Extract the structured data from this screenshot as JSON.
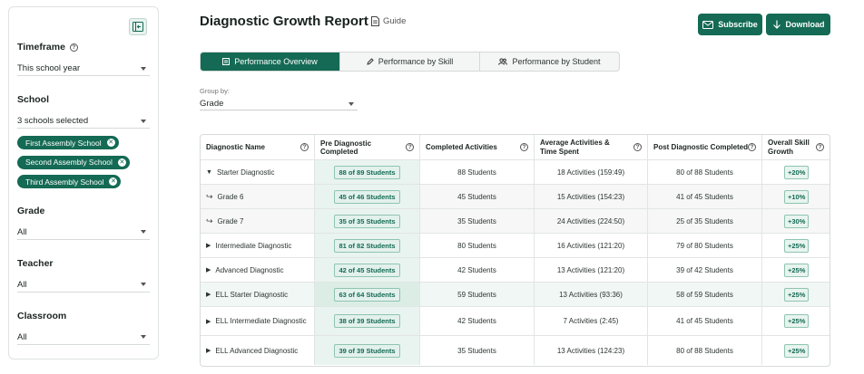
{
  "sidebar": {
    "filters": {
      "timeframe": {
        "label": "Timeframe",
        "value": "This school year"
      },
      "school": {
        "label": "School",
        "value": "3 schools selected",
        "chips": [
          "First Assembly School",
          "Second Assembly School",
          "Third Assembly School"
        ]
      },
      "grade": {
        "label": "Grade",
        "value": "All"
      },
      "teacher": {
        "label": "Teacher",
        "value": "All"
      },
      "classroom": {
        "label": "Classroom",
        "value": "All"
      }
    }
  },
  "header": {
    "title": "Diagnostic Growth Report",
    "guide": "Guide",
    "subscribe": "Subscribe",
    "download": "Download"
  },
  "tabs": [
    "Performance Overview",
    "Performance by Skill",
    "Performance by Student"
  ],
  "group_by": {
    "label": "Group by:",
    "value": "Grade"
  },
  "table": {
    "headers": [
      "Diagnostic Name",
      "Pre Diagnostic Completed",
      "Completed Activities",
      "Average Activities & Time Spent",
      "Post Diagnostic Completed",
      "Overall Skill Growth"
    ],
    "rows": [
      {
        "name": "Starter Diagnostic",
        "pre": "88 of 89 Students",
        "completed": "88 Students",
        "avg": "18 Activities (159:49)",
        "post": "80 of 88 Students",
        "growth": "+20%"
      },
      {
        "name": "Grade 6",
        "pre": "45 of 46 Students",
        "completed": "45 Students",
        "avg": "15 Activities (154:23)",
        "post": "41 of 45 Students",
        "growth": "+10%"
      },
      {
        "name": "Grade 7",
        "pre": "35 of 35 Students",
        "completed": "35 Students",
        "avg": "24 Activities (224:50)",
        "post": "25 of 35 Students",
        "growth": "+30%"
      },
      {
        "name": "Intermediate Diagnostic",
        "pre": "81 of 82 Students",
        "completed": "80 Students",
        "avg": "16 Activities (121:20)",
        "post": "79 of 80 Students",
        "growth": "+25%"
      },
      {
        "name": "Advanced Diagnostic",
        "pre": "42 of 45 Students",
        "completed": "42 Students",
        "avg": "13 Activities (121:20)",
        "post": "39 of 42 Students",
        "growth": "+25%"
      },
      {
        "name": "ELL Starter Diagnostic",
        "pre": "63 of 64 Students",
        "completed": "59 Students",
        "avg": "13 Activities (93:36)",
        "post": "58 of 59 Students",
        "growth": "+25%"
      },
      {
        "name": "ELL Intermediate Diagnostic",
        "pre": "38 of 39 Students",
        "completed": "42 Students",
        "avg": "7 Activities (2:45)",
        "post": "41 of 45 Students",
        "growth": "+25%"
      },
      {
        "name": "ELL Advanced Diagnostic",
        "pre": "39 of 39 Students",
        "completed": "35 Students",
        "avg": "13 Activities (124:23)",
        "post": "80 of 88 Students",
        "growth": "+25%"
      }
    ]
  },
  "colors": {
    "brand": "#146a54",
    "badge_bg": "#e3f1ec"
  }
}
